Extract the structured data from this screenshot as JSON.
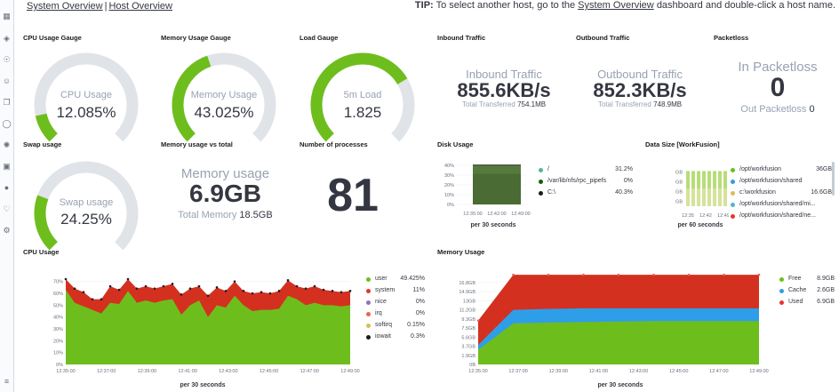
{
  "nav": {
    "system_overview": "System Overview",
    "host_overview": "Host Overview",
    "separator": "|",
    "tip_bold": "TIP:",
    "tip_before": "To select another host, go to the",
    "tip_link": "System Overview",
    "tip_after": "dashboard and double-click a host name."
  },
  "panels": {
    "cpu_gauge": {
      "title": "CPU Usage Gauge",
      "label": "CPU Usage",
      "value_text": "12.085%",
      "value": 12.085
    },
    "mem_gauge": {
      "title": "Memory Usage Gauge",
      "label": "Memory Usage",
      "value_text": "43.025%",
      "value": 43.025
    },
    "load_gauge": {
      "title": "Load Gauge",
      "label": "5m Load",
      "value_text": "1.825",
      "fraction": 0.72
    },
    "inbound": {
      "title": "Inbound Traffic",
      "label": "Inbound Traffic",
      "value": "855.6KB/s",
      "sub_label": "Total Transferred",
      "sub_value": "754.1MB"
    },
    "outbound": {
      "title": "Outbound Traffic",
      "label": "Outbound Traffic",
      "value": "852.3KB/s",
      "sub_label": "Total Transferred",
      "sub_value": "748.9MB"
    },
    "packetloss": {
      "title": "Packetloss",
      "label": "In Packetloss",
      "value": "0",
      "sub_label": "Out Packetloss",
      "sub_value": "0"
    },
    "swap_gauge": {
      "title": "Swap usage",
      "label": "Swap usage",
      "value_text": "24.25%",
      "value": 24.25
    },
    "mem_total": {
      "title": "Memory usage vs total",
      "label": "Memory usage",
      "value": "6.9GB",
      "sub_label": "Total Memory",
      "sub_value": "18.5GB"
    },
    "processes": {
      "title": "Number of processes",
      "value": "81"
    },
    "disk": {
      "title": "Disk Usage",
      "legend": [
        {
          "name": "/",
          "value": "31.2%",
          "color": "#54b399"
        },
        {
          "name": "/var/lib/nfs/rpc_pipefs",
          "value": "0%",
          "color": "#1a5c0e"
        },
        {
          "name": "C:\\",
          "value": "40.3%",
          "color": "#1a1c21"
        }
      ],
      "xlabel": "per 30 seconds"
    },
    "datasize": {
      "title": "Data Size [WorkFusion]",
      "legend": [
        {
          "name": "/opt/workfusion",
          "value": "36GB",
          "color": "#6dbe1d"
        },
        {
          "name": "/opt/workfusion/shared",
          "value": "",
          "color": "#2f9ee8"
        },
        {
          "name": "c:\\workfusion",
          "value": "16.6GB",
          "color": "#d6bf57"
        },
        {
          "name": "/opt/workfusion/shared/mi...",
          "value": "",
          "color": "#54b3c9"
        },
        {
          "name": "/opt/workfusion/shared/ne...",
          "value": "",
          "color": "#e7352b"
        }
      ],
      "xlabel": "per 60 seconds"
    },
    "cpu_usage": {
      "title": "CPU Usage",
      "legend": [
        {
          "name": "user",
          "value": "49.425%",
          "color": "#6dbe1d"
        },
        {
          "name": "system",
          "value": "11%",
          "color": "#e7352b"
        },
        {
          "name": "nice",
          "value": "0%",
          "color": "#9170b8"
        },
        {
          "name": "irq",
          "value": "0%",
          "color": "#e7664c"
        },
        {
          "name": "softirq",
          "value": "0.15%",
          "color": "#d6bf57"
        },
        {
          "name": "iowait",
          "value": "0.3%",
          "color": "#1a1c21"
        }
      ],
      "xlabel": "per 30 seconds"
    },
    "memory_usage": {
      "title": "Memory Usage",
      "legend": [
        {
          "name": "Free",
          "value": "8.9GB",
          "color": "#6dbe1d"
        },
        {
          "name": "Cache",
          "value": "2.6GB",
          "color": "#2f9ee8"
        },
        {
          "name": "Used",
          "value": "6.9GB",
          "color": "#e7352b"
        }
      ],
      "xlabel": "per 30 seconds"
    }
  },
  "chart_data": [
    {
      "type": "area",
      "name": "disk",
      "x": [
        "12:35:00",
        "12:42:00",
        "12:49:00"
      ],
      "y_ticks": [
        "0%",
        "10%",
        "20%",
        "30%",
        "40%"
      ],
      "ylim": [
        0,
        40
      ],
      "series": [
        {
          "values": [
            31.2,
            31.2,
            31.2
          ]
        },
        {
          "values": [
            40.3,
            40.3,
            40.3
          ]
        }
      ],
      "xlabel": "per 30 seconds"
    },
    {
      "type": "bar",
      "name": "datasize",
      "x": [
        "12:35",
        "12:42",
        "12:49"
      ],
      "y_ticks": [
        "4.7GB",
        "14GB",
        "23.3GB",
        "32.6GB"
      ],
      "ylim": [
        0,
        36
      ],
      "xlabel": "per 60 seconds"
    },
    {
      "type": "area",
      "name": "cpu",
      "x": [
        "12:35:00",
        "12:37:00",
        "12:39:00",
        "12:41:00",
        "12:43:00",
        "12:45:00",
        "12:47:00",
        "12:49:00"
      ],
      "y_ticks": [
        "0%",
        "10%",
        "20%",
        "30%",
        "40%",
        "50%",
        "60%",
        "70%"
      ],
      "ylim": [
        0,
        75
      ],
      "series": [
        {
          "name": "user",
          "values": [
            63,
            52,
            49,
            46,
            43,
            52,
            51,
            62,
            52,
            54,
            52,
            54,
            55,
            42,
            50,
            54,
            40,
            50,
            48,
            58,
            50,
            45,
            46,
            46,
            47,
            58,
            55,
            50,
            52,
            50,
            50,
            49,
            50
          ]
        },
        {
          "name": "system",
          "values": [
            72,
            64,
            61,
            55,
            55,
            66,
            63,
            72,
            64,
            66,
            64,
            66,
            68,
            59,
            64,
            66,
            58,
            65,
            62,
            70,
            62,
            60,
            61,
            60,
            62,
            71,
            66,
            64,
            66,
            63,
            62,
            61,
            62
          ]
        }
      ],
      "xlabel": "per 30 seconds"
    },
    {
      "type": "area",
      "name": "memory",
      "x": [
        "12:35:00",
        "12:37:00",
        "12:39:00",
        "12:41:00",
        "12:43:00",
        "12:45:00",
        "12:47:00",
        "12:49:00"
      ],
      "y_ticks": [
        "0B",
        "1.9GB",
        "3.7GB",
        "5.6GB",
        "7.5GB",
        "9.3GB",
        "11.2GB",
        "13GB",
        "14.9GB",
        "16.8GB"
      ],
      "ylim": [
        0,
        18.6
      ],
      "series": [
        {
          "name": "Free",
          "values": [
            3.0,
            8.4,
            8.6,
            8.7,
            8.8,
            8.9,
            8.9,
            8.9,
            8.9
          ]
        },
        {
          "name": "Cache",
          "values": [
            4.0,
            11.2,
            11.4,
            11.5,
            11.5,
            11.5,
            11.5,
            11.5,
            11.5
          ]
        },
        {
          "name": "Used",
          "values": [
            9.0,
            18.4,
            18.4,
            18.4,
            18.4,
            18.4,
            18.4,
            18.4,
            18.4
          ]
        }
      ],
      "xlabel": "per 30 seconds"
    }
  ]
}
